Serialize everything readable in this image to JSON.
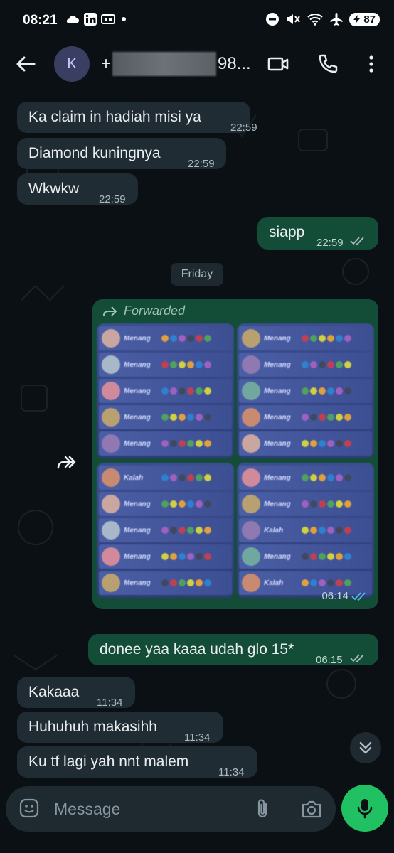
{
  "status_bar": {
    "time": "08:21",
    "battery": "87",
    "left_icons": [
      "weather-icon",
      "linkedin-icon",
      "cast-icon",
      "dot-icon"
    ],
    "right_icons": [
      "dnd-icon",
      "mute-icon",
      "wifi-icon",
      "airplane-icon"
    ]
  },
  "header": {
    "avatar_letter": "K",
    "contact_prefix": "+",
    "contact_suffix": "98..."
  },
  "messages": [
    {
      "dir": "in",
      "text": "Ka claim in hadiah misi ya",
      "time": "22:59"
    },
    {
      "dir": "in",
      "text": "Diamond kuningnya",
      "time": "22:59"
    },
    {
      "dir": "in",
      "text": "Wkwkw",
      "time": "22:59"
    },
    {
      "dir": "out",
      "text": "siapp",
      "time": "22:59",
      "status": "read"
    }
  ],
  "date_separator": "Friday",
  "forwarded": {
    "label": "Forwarded",
    "time": "06:14",
    "status": "read",
    "tiles": [
      [
        "Menang",
        "Menang",
        "Menang",
        "Menang",
        "Menang"
      ],
      [
        "Menang",
        "Menang",
        "Menang",
        "Menang",
        "Menang"
      ],
      [
        "Kalah",
        "Menang",
        "Menang",
        "Menang",
        "Menang"
      ],
      [
        "Menang",
        "Menang",
        "Kalah",
        "Menang",
        "Kalah"
      ]
    ]
  },
  "messages_after": [
    {
      "dir": "out",
      "text": "donee yaa kaaa udah glo 15*",
      "time": "06:15",
      "status": "read"
    },
    {
      "dir": "in",
      "text": "Kakaaa",
      "time": "11:34"
    },
    {
      "dir": "in",
      "text": "Huhuhuh makasihh",
      "time": "11:34"
    },
    {
      "dir": "in",
      "text": "Ku tf lagi yah nnt malem",
      "time": "11:34"
    }
  ],
  "input": {
    "placeholder": "Message"
  },
  "colors": {
    "incoming": "#202c33",
    "outgoing": "#144d37",
    "accent": "#21c063",
    "background": "#0b1014"
  }
}
